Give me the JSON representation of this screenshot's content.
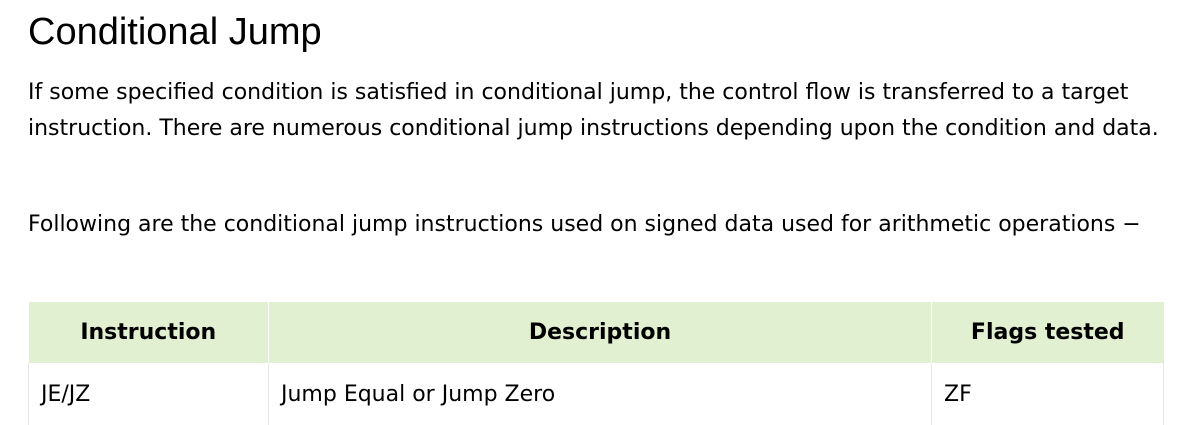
{
  "page": {
    "title": "Conditional Jump",
    "paragraph1": "If some specified condition is satisfied in conditional jump, the control flow is transferred to a target instruction. There are numerous conditional jump instructions depending upon the condition and data.",
    "paragraph2": "Following are the conditional jump instructions used on signed data used for arithmetic operations −"
  },
  "table": {
    "headers": [
      "Instruction",
      "Description",
      "Flags tested"
    ],
    "rows": [
      [
        "JE/JZ",
        "Jump Equal or Jump Zero",
        "ZF"
      ]
    ],
    "header_bg": "#e2f0d2"
  }
}
